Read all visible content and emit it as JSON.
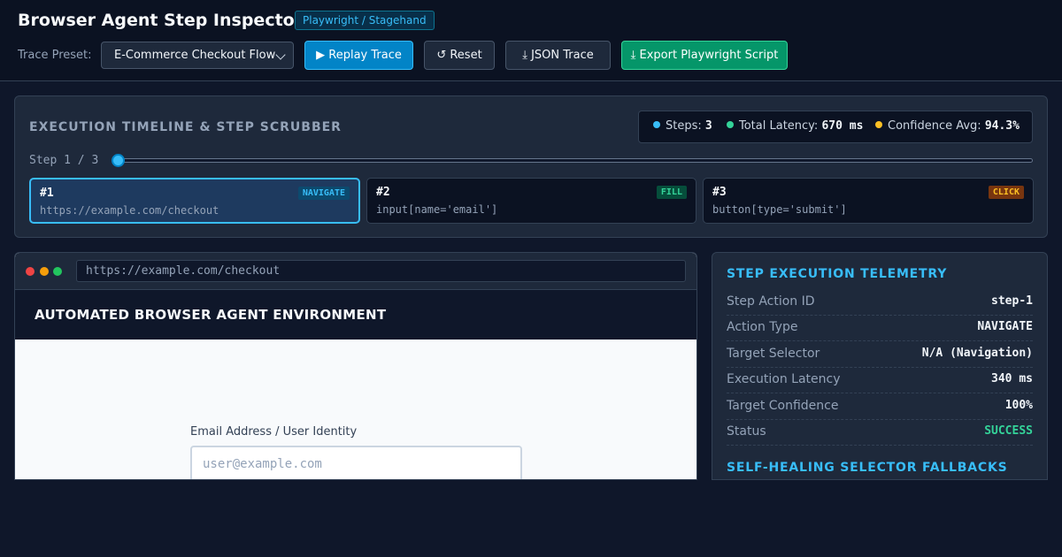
{
  "header": {
    "title": "Browser Agent Step Inspector",
    "tag": "Playwright / Stagehand",
    "preset_label": "Trace Preset:",
    "preset_value": "E-Commerce Checkout Flow",
    "buttons": {
      "replay": "▶ Replay Trace",
      "reset": "↺ Reset",
      "json": "⤓ JSON Trace",
      "export": "⤓ Export Playwright Script"
    }
  },
  "timeline": {
    "title": "EXECUTION TIMELINE & STEP SCRUBBER",
    "stats": {
      "steps_label": "Steps:",
      "steps_value": "3",
      "latency_label": "Total Latency:",
      "latency_value": "670 ms",
      "confidence_label": "Confidence Avg:",
      "confidence_value": "94.3%"
    },
    "step_counter": "Step 1 / 3",
    "scrubber_position": 0,
    "steps": [
      {
        "num": "#1",
        "action": "NAVIGATE",
        "target": "https://example.com/checkout"
      },
      {
        "num": "#2",
        "action": "FILL",
        "target": "input[name='email']"
      },
      {
        "num": "#3",
        "action": "CLICK",
        "target": "button[type='submit']"
      }
    ]
  },
  "browser": {
    "url": "https://example.com/checkout",
    "env_title": "AUTOMATED BROWSER AGENT ENVIRONMENT",
    "form_label": "Email Address / User Identity",
    "form_placeholder": "user@example.com"
  },
  "telemetry": {
    "title": "STEP EXECUTION TELEMETRY",
    "rows": [
      {
        "key": "Step Action ID",
        "value": "step-1"
      },
      {
        "key": "Action Type",
        "value": "NAVIGATE"
      },
      {
        "key": "Target Selector",
        "value": "N/A (Navigation)"
      },
      {
        "key": "Execution Latency",
        "value": "340 ms"
      },
      {
        "key": "Target Confidence",
        "value": "100%"
      },
      {
        "key": "Status",
        "value": "SUCCESS"
      }
    ],
    "fallbacks_title": "SELF-HEALING SELECTOR FALLBACKS"
  },
  "colors": {
    "accent": "#38bdf8",
    "success": "#34d399",
    "warning": "#fbbf24",
    "background": "#0f172a"
  }
}
